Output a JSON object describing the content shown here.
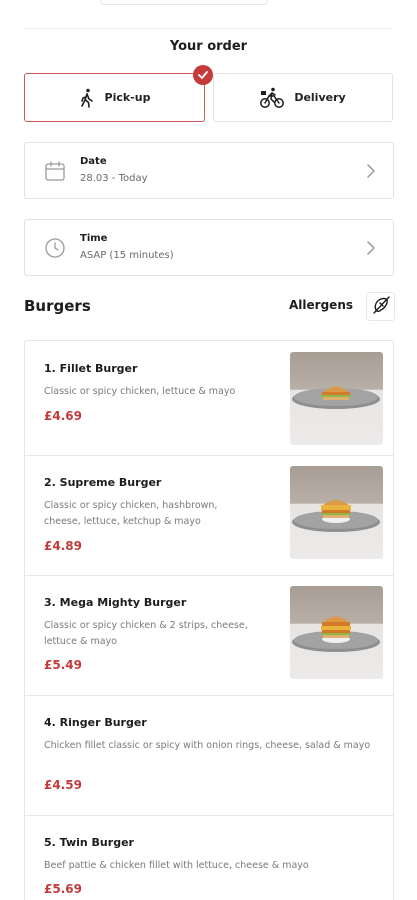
{
  "order": {
    "title": "Your order",
    "modes": [
      {
        "label": "Pick-up",
        "selected": true,
        "icon": "walking-person-icon"
      },
      {
        "label": "Delivery",
        "selected": false,
        "icon": "cyclist-icon"
      }
    ],
    "date": {
      "label": "Date",
      "value": "28.03 - Today",
      "icon": "calendar-icon"
    },
    "time": {
      "label": "Time",
      "value": "ASAP (15 minutes)",
      "icon": "clock-icon"
    }
  },
  "menu": {
    "section_title": "Burgers",
    "allergens_label": "Allergens",
    "items": [
      {
        "name": "1. Fillet Burger",
        "description": "Classic or spicy chicken, lettuce & mayo",
        "price": "£4.69",
        "has_photo": true
      },
      {
        "name": "2. Supreme Burger",
        "description": "Classic or spicy chicken, hashbrown, cheese, lettuce, ketchup & mayo",
        "price": "£4.89",
        "has_photo": true
      },
      {
        "name": "3. Mega Mighty Burger",
        "description": "Classic or spicy chicken & 2 strips, cheese, lettuce & mayo",
        "price": "£5.49",
        "has_photo": true
      },
      {
        "name": "4. Ringer Burger",
        "description": "Chicken fillet classic or spicy with onion rings, cheese, salad & mayo",
        "price": "£4.59",
        "has_photo": false
      },
      {
        "name": "5. Twin Burger",
        "description": "Beef pattie & chicken fillet with lettuce, cheese & mayo",
        "price": "£5.69",
        "has_photo": false
      }
    ]
  },
  "colors": {
    "accent": "#c43b3b",
    "border": "#e2e2e2",
    "muted_text": "#7a7a7a"
  }
}
